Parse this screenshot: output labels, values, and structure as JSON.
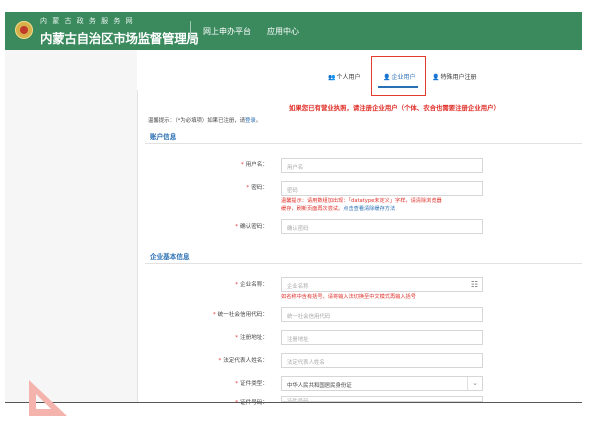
{
  "header": {
    "org_subtitle": "内 蒙 古 政 务 服 务 网",
    "org_name": "内蒙古自治区市场监督管理局",
    "nav": [
      "网上申办平台",
      "应用中心"
    ]
  },
  "tabs": [
    {
      "label": "个人用户",
      "icon": "users-icon",
      "active": false
    },
    {
      "label": "企业用户",
      "icon": "user-icon",
      "active": true
    },
    {
      "label": "特殊用户注册",
      "icon": "user-icon",
      "active": false
    }
  ],
  "warning": "如果您已有营业执照，请注册企业用户（个体、农合也需要注册企业用户）",
  "tip": {
    "text": "温馨提示：（*为必填项）如果已注册，请",
    "link": "登录",
    "suffix": "。"
  },
  "account_section": {
    "title": "账户信息",
    "username": {
      "label": "用户名：",
      "placeholder": "用户名"
    },
    "password": {
      "label": "密码：",
      "placeholder": "密码",
      "hint_line1": "温馨提示：请用数组加出现：「datatype未定义」字样，请清除浏览器",
      "hint_line2_prefix": "缓存，刷新页面再次尝试。",
      "hint_link": "点击查看清除缓存方法"
    },
    "confirm": {
      "label": "确认密码：",
      "placeholder": "确认密码"
    }
  },
  "company_section": {
    "title": "企业基本信息",
    "company_name": {
      "label": "企业名称：",
      "placeholder": "企业名称",
      "hint": "如名称中含有括号，请将输入法切换至中文模式再输入括号"
    },
    "credit_code": {
      "label": "统一社会信用代码：",
      "placeholder": "统一社会信用代码"
    },
    "address": {
      "label": "注册地址：",
      "placeholder": "注册地址"
    },
    "legal_rep": {
      "label": "法定代表人姓名：",
      "placeholder": "法定代表人姓名"
    },
    "id_type": {
      "label": "证件类型：",
      "value": "中华人民共和国居民身份证"
    },
    "id_number": {
      "label": "证件号码：",
      "placeholder": "证件号码"
    }
  },
  "colors": {
    "header_green": "#3a8a5e",
    "accent_blue": "#2a6fb3",
    "warning_red": "#e0302a",
    "highlight_red": "#e53a2e"
  }
}
